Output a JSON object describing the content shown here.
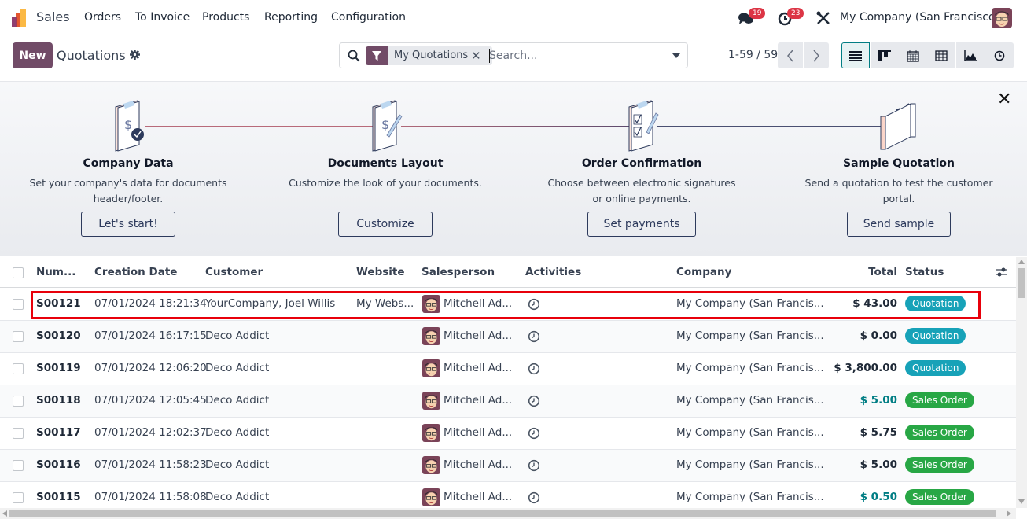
{
  "app": {
    "name": "Sales",
    "menu": [
      "Orders",
      "To Invoice",
      "Products",
      "Reporting",
      "Configuration"
    ],
    "messages_count": "19",
    "activities_count": "23",
    "company": "My Company (San Francisco)"
  },
  "control": {
    "new_label": "New",
    "title": "Quotations",
    "search": {
      "facet": "My Quotations",
      "placeholder": "Search...",
      "value": ""
    },
    "pager": "1-59 / 59",
    "views": [
      "list",
      "kanban",
      "calendar",
      "pivot",
      "graph",
      "activity"
    ],
    "active_view": "list"
  },
  "onboarding": {
    "steps": [
      {
        "title": "Company Data",
        "desc1": "Set your company's data for documents",
        "desc2": "header/footer.",
        "button": "Let's start!"
      },
      {
        "title": "Documents Layout",
        "desc1": "Customize the look of your documents.",
        "desc2": "",
        "button": "Customize"
      },
      {
        "title": "Order Confirmation",
        "desc1": "Choose between electronic signatures",
        "desc2": "or online payments.",
        "button": "Set payments"
      },
      {
        "title": "Sample Quotation",
        "desc1": "Send a quotation to test the customer",
        "desc2": "portal.",
        "button": "Send sample"
      }
    ]
  },
  "table": {
    "columns": [
      "Num...",
      "Creation Date",
      "Customer",
      "Website",
      "Salesperson",
      "Activities",
      "Company",
      "Total",
      "Status"
    ],
    "rows": [
      {
        "number": "S00121",
        "date": "07/01/2024 18:21:34",
        "customer": "YourCompany, Joel Willis",
        "website": "My Webs...",
        "salesperson": "Mitchell Ad...",
        "company": "My Company (San Francis...",
        "total": "$ 43.00",
        "status": "Quotation"
      },
      {
        "number": "S00120",
        "date": "07/01/2024 16:17:15",
        "customer": "Deco Addict",
        "website": "",
        "salesperson": "Mitchell Ad...",
        "company": "My Company (San Francis...",
        "total": "$ 0.00",
        "status": "Quotation"
      },
      {
        "number": "S00119",
        "date": "07/01/2024 12:06:20",
        "customer": "Deco Addict",
        "website": "",
        "salesperson": "Mitchell Ad...",
        "company": "My Company (San Francis...",
        "total": "$ 3,800.00",
        "status": "Quotation"
      },
      {
        "number": "S00118",
        "date": "07/01/2024 12:05:45",
        "customer": "Deco Addict",
        "website": "",
        "salesperson": "Mitchell Ad...",
        "company": "My Company (San Francis...",
        "total": "$ 5.00",
        "status": "Sales Order"
      },
      {
        "number": "S00117",
        "date": "07/01/2024 12:02:37",
        "customer": "Deco Addict",
        "website": "",
        "salesperson": "Mitchell Ad...",
        "company": "My Company (San Francis...",
        "total": "$ 5.75",
        "status": "Sales Order"
      },
      {
        "number": "S00116",
        "date": "07/01/2024 11:58:23",
        "customer": "Deco Addict",
        "website": "",
        "salesperson": "Mitchell Ad...",
        "company": "My Company (San Francis...",
        "total": "$ 5.00",
        "status": "Sales Order"
      },
      {
        "number": "S00115",
        "date": "07/01/2024 11:58:08",
        "customer": "Deco Addict",
        "website": "",
        "salesperson": "Mitchell Ad...",
        "company": "My Company (San Francis...",
        "total": "$ 0.50",
        "status": "Sales Order"
      }
    ],
    "total_colors": [
      "#1f2937",
      "#1f2937",
      "#1f2937",
      "#017e84",
      "#1f2937",
      "#1f2937",
      "#017e84"
    ],
    "status_colors": {
      "Quotation": "#17a2b8",
      "Sales Order": "#28a745"
    }
  },
  "colors": {
    "brand": "#714b67",
    "highlight": "#e8000b"
  }
}
